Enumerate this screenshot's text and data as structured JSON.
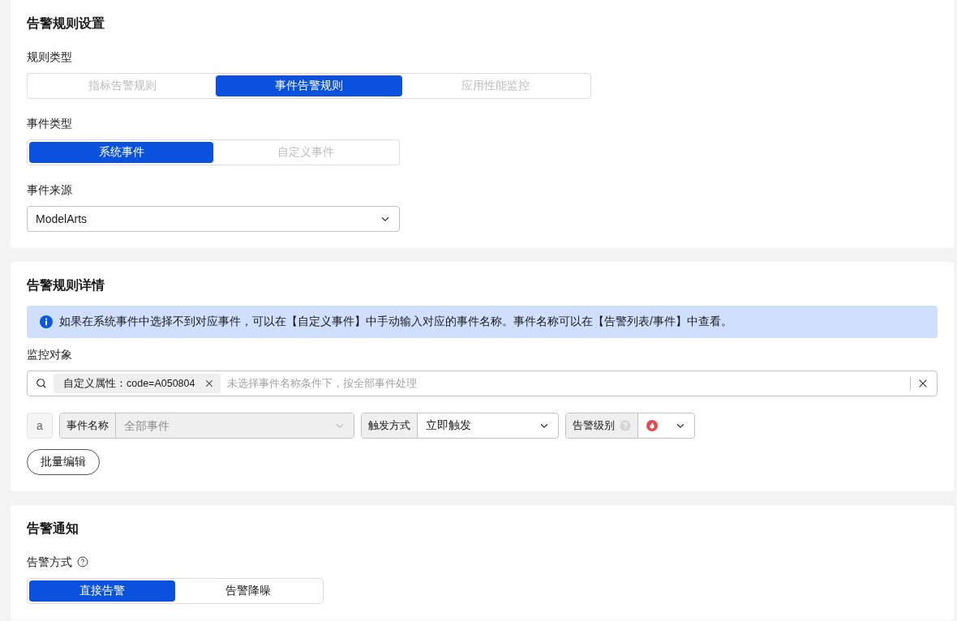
{
  "rule_settings": {
    "title": "告警规则设置",
    "rule_type": {
      "label": "规则类型",
      "options": [
        {
          "label": "指标告警规则",
          "selected": false,
          "disabled": true
        },
        {
          "label": "事件告警规则",
          "selected": true,
          "disabled": false
        },
        {
          "label": "应用性能监控",
          "selected": false,
          "disabled": true
        }
      ]
    },
    "event_type": {
      "label": "事件类型",
      "options": [
        {
          "label": "系统事件",
          "selected": true,
          "disabled": false
        },
        {
          "label": "自定义事件",
          "selected": false,
          "disabled": true
        }
      ]
    },
    "event_source": {
      "label": "事件来源",
      "value": "ModelArts"
    }
  },
  "rule_details": {
    "title": "告警规则详情",
    "info": "如果在系统事件中选择不到对应事件，可以在【自定义事件】中手动输入对应的事件名称。事件名称可以在【告警列表/事件】中查看。",
    "monitor_object": {
      "label": "监控对象",
      "tags": [
        "自定义属性：code=A050804"
      ],
      "placeholder": "未选择事件名称条件下，按全部事件处理"
    },
    "condition": {
      "index": "a",
      "event_name": {
        "label": "事件名称",
        "placeholder": "全部事件",
        "disabled": true
      },
      "trigger": {
        "label": "触发方式",
        "value": "立即触发",
        "disabled": false
      },
      "level": {
        "label": "告警级别"
      }
    },
    "batch_button": "批量编辑"
  },
  "notification": {
    "title": "告警通知",
    "mode": {
      "label": "告警方式",
      "options": [
        {
          "label": "直接告警",
          "selected": true,
          "disabled": false
        },
        {
          "label": "告警降噪",
          "selected": false,
          "disabled": false
        }
      ]
    }
  }
}
